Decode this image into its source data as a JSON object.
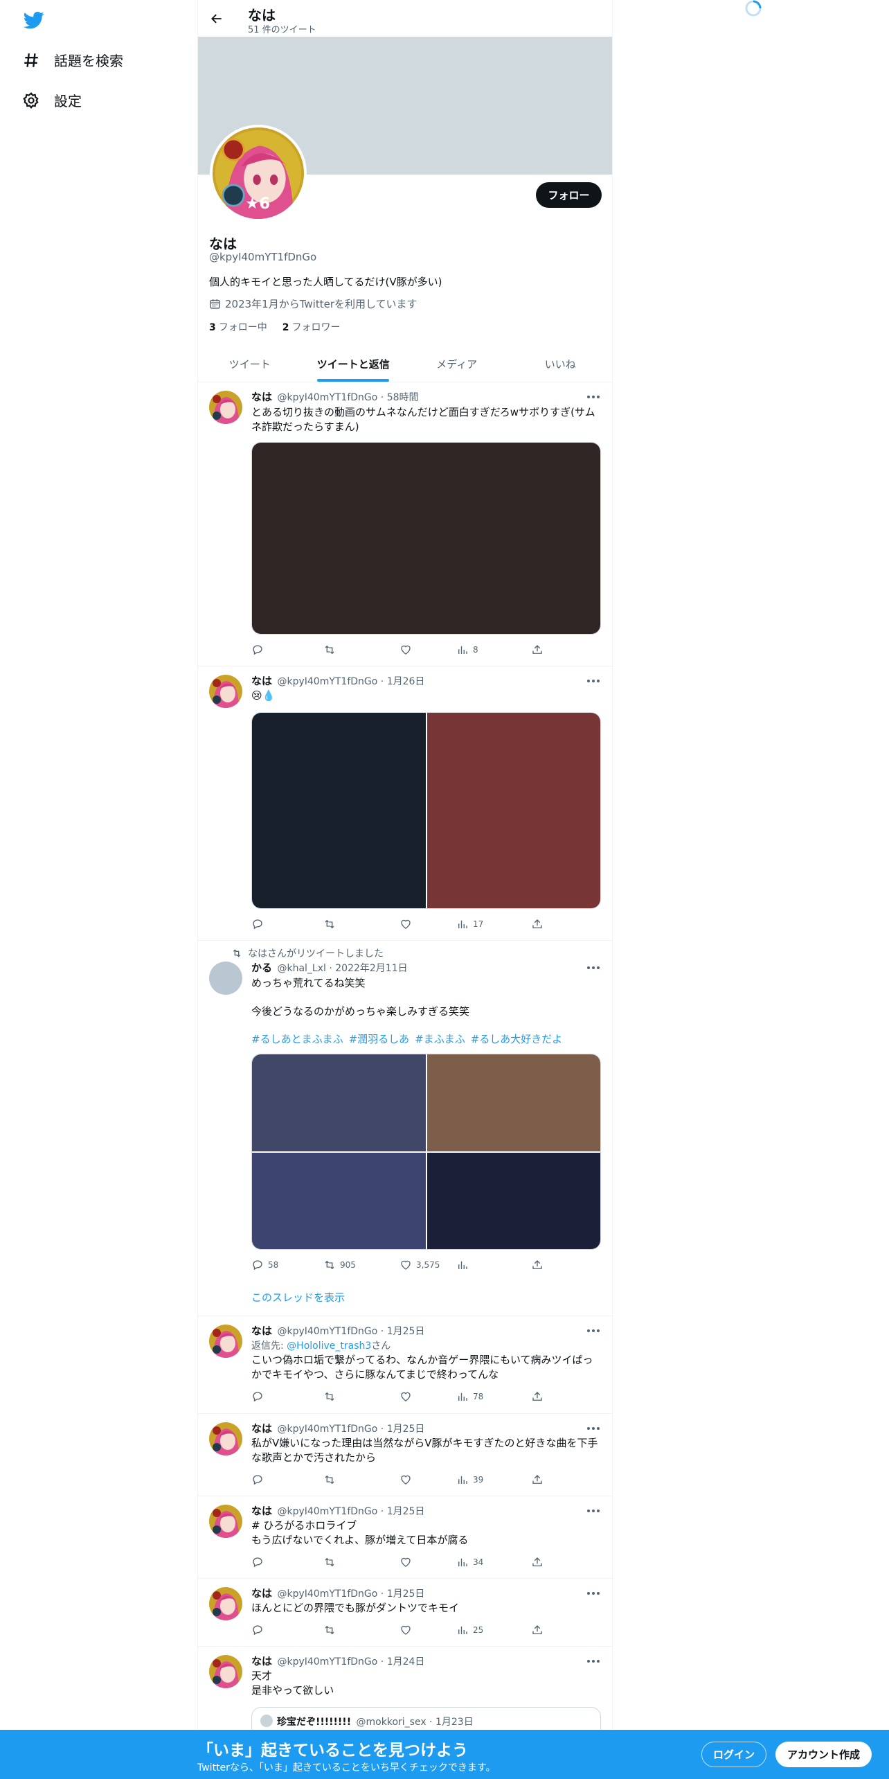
{
  "colors": {
    "accent": "#1d9bf0",
    "banner": "#cfd9de",
    "text": "#0f1419",
    "muted": "#536471"
  },
  "nav": {
    "explore": "話題を検索",
    "settings": "設定"
  },
  "header": {
    "name": "なは",
    "tweet_count": "51 件のツイート"
  },
  "profile": {
    "name": "なは",
    "handle": "@kpyI40mYT1fDnGo",
    "bio": "個人的キモイと思った人晒してるだけ(V豚が多い)",
    "joined": "2023年1月からTwitterを利用しています",
    "following_count": "3",
    "following_label": "フォロー中",
    "followers_count": "2",
    "followers_label": "フォロワー",
    "follow_button": "フォロー",
    "avatar_badge": "★6"
  },
  "tabs": [
    "ツイート",
    "ツイートと返信",
    "メディア",
    "いいね"
  ],
  "tweets": [
    {
      "name": "なは",
      "handle": "@kpyI40mYT1fDnGo",
      "time": "58時間",
      "text": "とある切り抜きの動画のサムネなんだけど面白すぎだろwサボりすぎ(サムネ詐欺だったらすまん)",
      "views": "8",
      "media_colors": [
        "#2e2524"
      ]
    },
    {
      "name": "なは",
      "handle": "@kpyI40mYT1fDnGo",
      "time": "1月26日",
      "text": "😢💧",
      "views": "17",
      "media_colors": [
        "#17202a",
        "#773536"
      ]
    },
    {
      "retweeted_by": "なはさんがリツイートしました",
      "name": "かる",
      "handle": "@khal_Lxl",
      "time": "2022年2月11日",
      "text_line1": "めっちゃ荒れてるね笑笑",
      "text_line2": "今後どうなるのかがめっちゃ楽しみすぎる笑笑",
      "hashtags": [
        "#るしあとまふまふ",
        "#潤羽るしあ",
        "#まふまふ",
        "#るしあ大好きだよ"
      ],
      "replies": "58",
      "retweets": "905",
      "likes": "3,575",
      "thread_link": "このスレッドを表示",
      "media_colors": [
        "#414767",
        "#7c5e4a",
        "#3d4470",
        "#1b1f38"
      ]
    },
    {
      "name": "なは",
      "handle": "@kpyI40mYT1fDnGo",
      "time": "1月25日",
      "reply_prefix": "返信先: ",
      "reply_to": "@Hololive_trash3",
      "reply_suffix": "さん",
      "text": "こいつ偽ホロ垢で繋がってるわ、なんか音ゲー界隈にもいて病みツイばっかでキモイやつ、さらに豚なんてまじで終わってんな",
      "views": "78"
    },
    {
      "name": "なは",
      "handle": "@kpyI40mYT1fDnGo",
      "time": "1月25日",
      "text": "私がV嫌いになった理由は当然ながらV豚がキモすぎたのと好きな曲を下手な歌声とかで汚されたから",
      "views": "39"
    },
    {
      "name": "なは",
      "handle": "@kpyI40mYT1fDnGo",
      "time": "1月25日",
      "text_line1": "# ひろがるホロライブ",
      "text_line2": "もう広げないでくれよ、豚が増えて日本が腐る",
      "views": "34"
    },
    {
      "name": "なは",
      "handle": "@kpyI40mYT1fDnGo",
      "time": "1月25日",
      "text": "ほんとにどの界隈でも豚がダントツでキモイ",
      "views": "25"
    },
    {
      "name": "なは",
      "handle": "@kpyI40mYT1fDnGo",
      "time": "1月24日",
      "text_line1": "天才",
      "text_line2": "是非やって欲しい",
      "quote_name": "珍宝だぞ!!!!!!!!",
      "quote_handle": "@mokkori_sex",
      "quote_time": "1月23日"
    }
  ],
  "bottom": {
    "title": "「いま」起きていることを見つけよう",
    "subtitle": "Twitterなら、「いま」起きていることをいち早くチェックできます。",
    "login": "ログイン",
    "signup": "アカウント作成"
  }
}
